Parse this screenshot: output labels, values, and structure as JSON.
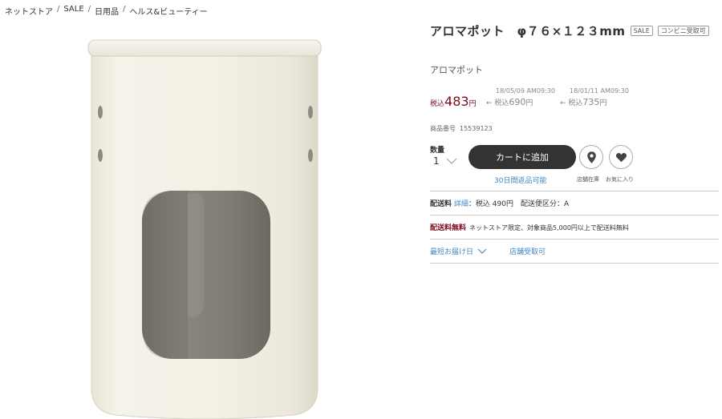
{
  "breadcrumb": [
    "ネットストア",
    "SALE",
    "日用品",
    "ヘルス&ビューティー"
  ],
  "breadcrumb_separator": "/",
  "product": {
    "title": "アロマポット　φ７６×１２３mm",
    "tags": [
      "SALE",
      "コンビニ受取可"
    ],
    "subtitle": "アロマポット",
    "price": {
      "tax_label": "税込",
      "value": "483",
      "unit": "円"
    },
    "history": [
      {
        "date": "18/05/09 AM09:30",
        "prefix": "← 税込",
        "value": "690",
        "unit": "円"
      },
      {
        "date": "18/01/11 AM09:30",
        "prefix": "← 税込",
        "value": "735",
        "unit": "円"
      }
    ],
    "code_label": "商品番号",
    "code": "15539123"
  },
  "cart": {
    "qty_label": "数量",
    "qty_value": "1",
    "add_label": "カートに追加",
    "return_label": "30日間返品可能",
    "store_label": "店舗在庫",
    "fav_label": "お気に入り"
  },
  "shipping": {
    "label": "配送料",
    "detail_link": "詳細",
    "text": "：税込 490円　配送便区分：A"
  },
  "free_shipping": {
    "label": "配送料無料",
    "text": "ネットストア限定、対象商品5,000円以上で配送料無料"
  },
  "links": {
    "delivery": "最短お届け日",
    "store_pickup": "店舗受取可"
  },
  "colors": {
    "price": "#7d0a1e",
    "link": "#3f86c4",
    "button": "#333333",
    "pot": "#f1efe4"
  }
}
